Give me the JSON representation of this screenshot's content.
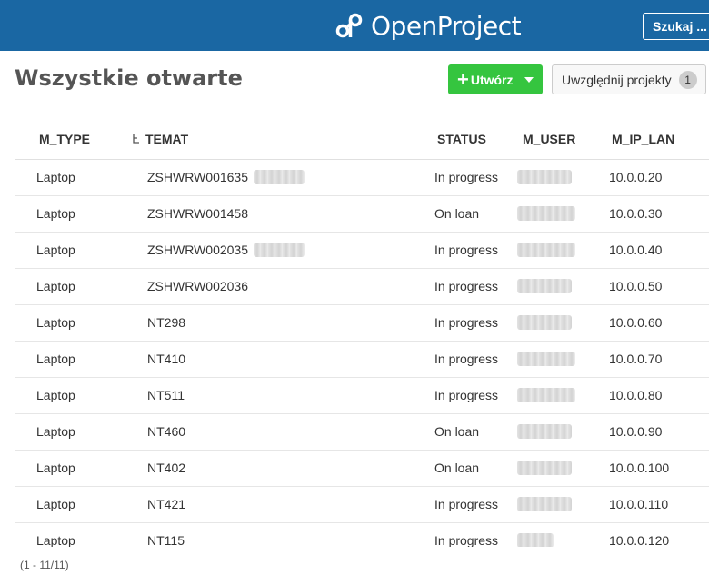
{
  "header": {
    "logo_text": "OpenProject",
    "search_label": "Szukaj ...",
    "background": "#1a67a3"
  },
  "toolbar": {
    "page_title": "Wszystkie otwarte",
    "create_label": "Utwórz",
    "include_projects_label": "Uwzględnij projekty",
    "include_projects_count": "1",
    "create_color": "#35c53f"
  },
  "table": {
    "columns": [
      "M_TYPE",
      "TEMAT",
      "STATUS",
      "M_USER",
      "M_IP_LAN"
    ],
    "rows": [
      {
        "type": "Laptop",
        "subject": "ZSHWRW001635",
        "status": "In progress",
        "ip": "10.0.0.20"
      },
      {
        "type": "Laptop",
        "subject": "ZSHWRW001458",
        "status": "On loan",
        "ip": "10.0.0.30"
      },
      {
        "type": "Laptop",
        "subject": "ZSHWRW002035",
        "status": "In progress",
        "ip": "10.0.0.40"
      },
      {
        "type": "Laptop",
        "subject": "ZSHWRW002036",
        "status": "In progress",
        "ip": "10.0.0.50"
      },
      {
        "type": "Laptop",
        "subject": "NT298",
        "status": "In progress",
        "ip": "10.0.0.60"
      },
      {
        "type": "Laptop",
        "subject": "NT410",
        "status": "In progress",
        "ip": "10.0.0.70"
      },
      {
        "type": "Laptop",
        "subject": "NT511",
        "status": "In progress",
        "ip": "10.0.0.80"
      },
      {
        "type": "Laptop",
        "subject": "NT460",
        "status": "On loan",
        "ip": "10.0.0.90"
      },
      {
        "type": "Laptop",
        "subject": "NT402",
        "status": "On loan",
        "ip": "10.0.0.100"
      },
      {
        "type": "Laptop",
        "subject": "NT421",
        "status": "In progress",
        "ip": "10.0.0.110"
      },
      {
        "type": "Laptop",
        "subject": "NT115",
        "status": "In progress",
        "ip": "10.0.0.120"
      }
    ]
  },
  "footer": {
    "count_label": "(1 - 11/11)"
  }
}
